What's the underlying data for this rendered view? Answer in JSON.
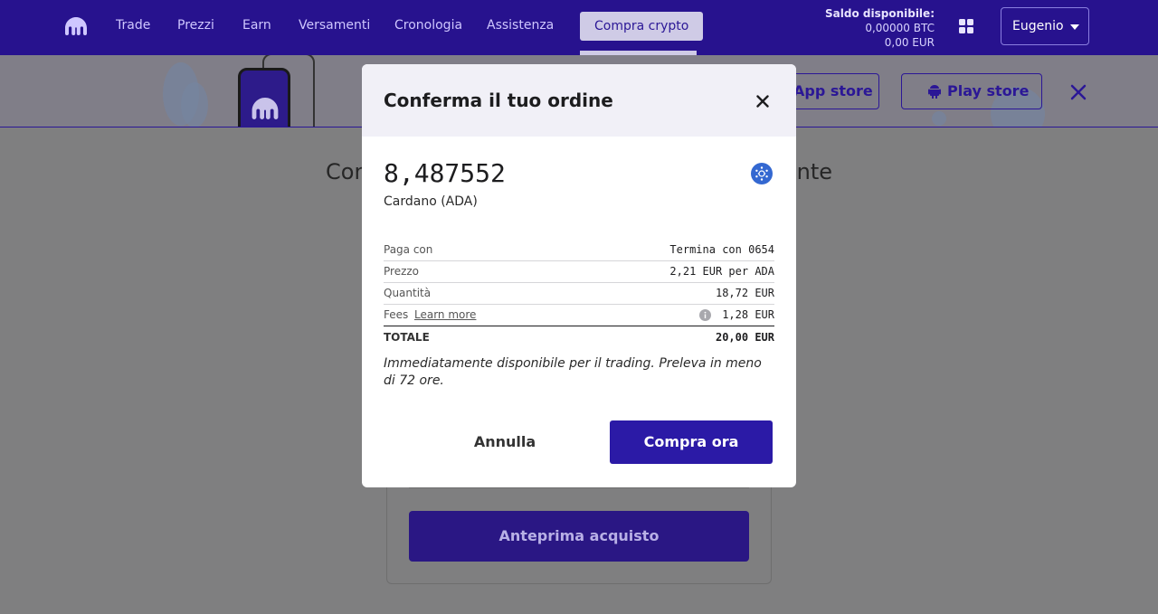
{
  "nav": {
    "items": [
      "Trade",
      "Prezzi",
      "Earn",
      "Versamenti",
      "Cronologia",
      "Assistenza"
    ],
    "active_item": "Compra crypto"
  },
  "balance": {
    "label": "Saldo disponibile:",
    "btc": "0,00000 BTC",
    "eur": "0,00 EUR"
  },
  "user": {
    "name": "Eugenio"
  },
  "banner": {
    "app_store": "App store",
    "play_store": "Play store"
  },
  "page": {
    "title_left": "Con",
    "title_right": "ente",
    "preview_button": "Anteprima acquisto"
  },
  "modal": {
    "title": "Conferma il tuo ordine",
    "amount": "8,487552",
    "asset": "Cardano (ADA)",
    "rows": {
      "pay_with": {
        "label": "Paga con",
        "value": "Termina con 0654"
      },
      "price": {
        "label": "Prezzo",
        "value": "2,21 EUR per ADA"
      },
      "quantity": {
        "label": "Quantità",
        "value": "18,72 EUR"
      },
      "fees": {
        "label": "Fees",
        "link": "Learn more",
        "value": "1,28 EUR"
      },
      "total": {
        "label": "TOTALE",
        "value": "20,00 EUR"
      }
    },
    "note": "Immediatamente disponibile per il trading. Preleva in meno di 72 ore.",
    "cancel": "Annulla",
    "confirm": "Compra ora"
  },
  "colors": {
    "brand": "#27128e",
    "primary_button": "#2b1aa6",
    "ada": "#3468d1"
  },
  "icons": [
    "kraken-logo-icon",
    "apps-grid-icon",
    "chevron-down-icon",
    "android-icon",
    "close-icon",
    "cardano-icon",
    "info-icon"
  ]
}
